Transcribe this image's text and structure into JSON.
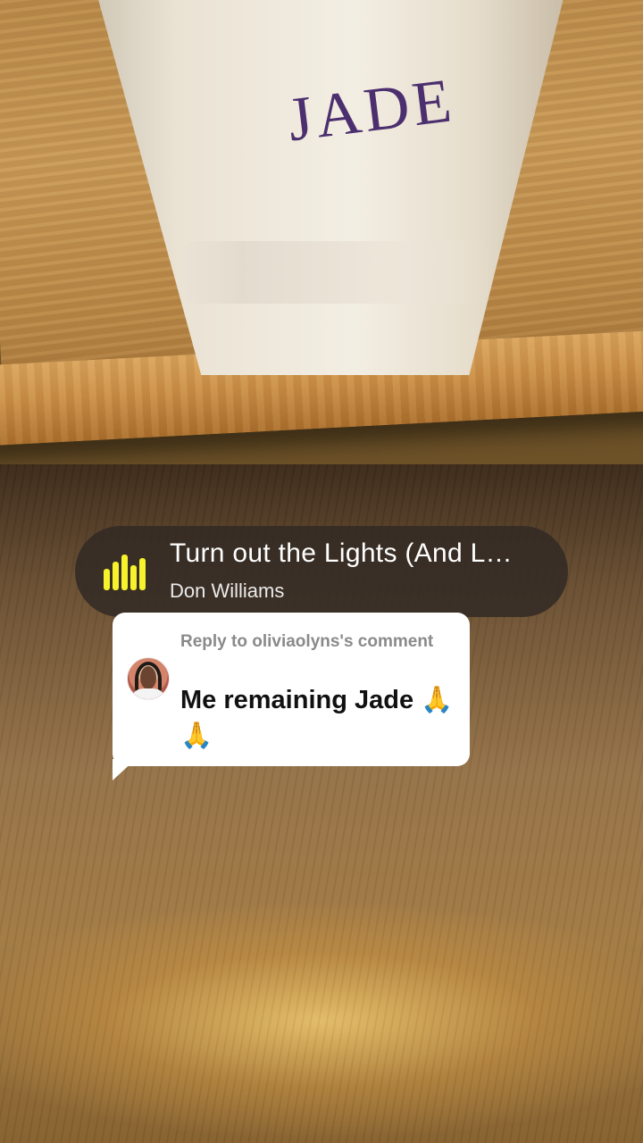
{
  "background_photo": {
    "cup_name": "JADE"
  },
  "music": {
    "icon": "sound-bars-icon",
    "title": "Turn out the Lights (And L…",
    "artist": "Don Williams",
    "accent_color": "#f6f22b"
  },
  "reply": {
    "label": "Reply to oliviaolyns's comment",
    "comment": "Me remaining Jade 🙏🙏",
    "avatar_icon": "user-avatar"
  }
}
